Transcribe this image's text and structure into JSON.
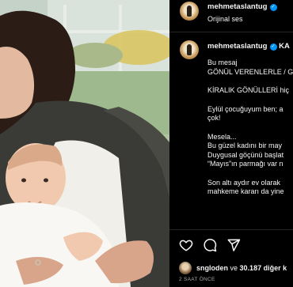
{
  "post": {
    "username": "mehmetaslantug",
    "audio_label": "Orijinal ses",
    "verified_icon": "verified-badge-icon"
  },
  "caption": {
    "username": "mehmetaslantug",
    "title_start": "KA",
    "lines": [
      {
        "text": "Bu mesaj",
        "spacing": "tight"
      },
      {
        "text": "GÖNÜL VERENLERLE / G",
        "spacing": "normal"
      },
      {
        "text": "KİRALIK GÖNÜLLERİ hiç",
        "spacing": "normal"
      },
      {
        "text": "Eylül çocuğuyum ben; a",
        "spacing": "tight"
      },
      {
        "text": "çok!",
        "spacing": "normal"
      },
      {
        "text": "Mesela...",
        "spacing": "tight"
      },
      {
        "text": "Bu güzel kadını bir may",
        "spacing": "tight"
      },
      {
        "text": "Duygusal göçünü başlat",
        "spacing": "tight"
      },
      {
        "text": "“Mayıs”ın parmağı var n",
        "spacing": "normal"
      },
      {
        "text": "Son altı aydır ev olarak",
        "spacing": "tight"
      },
      {
        "text": "mahkeme kararı da yine",
        "spacing": "tight"
      }
    ]
  },
  "actions": {
    "like_icon": "heart-icon",
    "comment_icon": "comment-icon",
    "share_icon": "share-icon"
  },
  "likes": {
    "first_user": "sngloden",
    "connector": "ve",
    "others": "30.187 diğer k"
  },
  "timestamp": "2 SAAT ÖNCE",
  "colors": {
    "background": "#000000",
    "text": "#f5f5f5",
    "muted": "#a8a8a8",
    "divider": "#262626",
    "verified": "#0095f6"
  }
}
